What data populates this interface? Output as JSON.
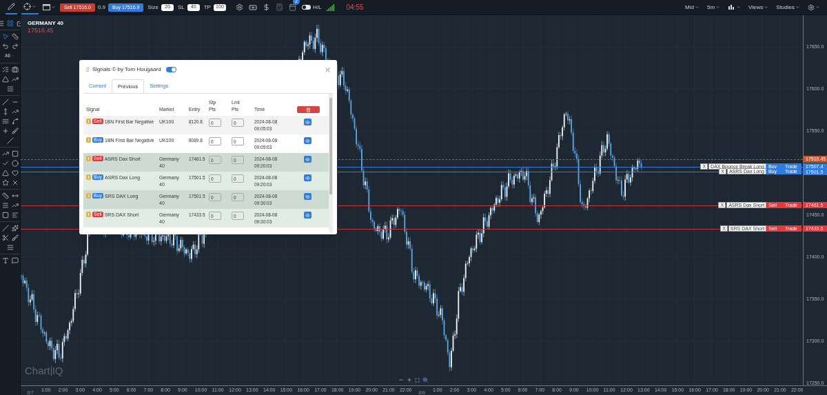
{
  "toolbar": {
    "tools": [
      {
        "kind": "pencil",
        "selected": true
      },
      {
        "kind": "crosshair",
        "selected": true
      }
    ],
    "sell_button": "Sell 17516.0",
    "spread": "0.9",
    "buy_button": "Buy 17516.9",
    "fields": [
      {
        "label": "Size",
        "value": "20"
      },
      {
        "label": "SL",
        "value": "40"
      },
      {
        "label": "TP",
        "value": "100"
      }
    ],
    "calendar_badge": "2",
    "hl_toggle": {
      "label": "H/L",
      "on": false
    },
    "clock": "04:55",
    "menus": [
      {
        "kind": "text",
        "label": "Mid"
      },
      {
        "kind": "text",
        "label": "5m"
      },
      {
        "kind": "chart-type"
      },
      {
        "kind": "text",
        "label": "Views"
      },
      {
        "kind": "text",
        "label": "Studies"
      },
      {
        "kind": "settings"
      }
    ]
  },
  "sidebar": {
    "filter": "All"
  },
  "chart": {
    "symbol": "GERMANY 40",
    "price": "17516.45",
    "logo": {
      "main": "Chart",
      "suffix": "IQ"
    },
    "y_axis": [
      "17650.0",
      "17600.0",
      "17550.0",
      "17450.0",
      "17400.0",
      "17350.0",
      "17300.0",
      "17250.0"
    ],
    "x_axis": [
      {
        "date": "8/7",
        "hours": [
          "1:00",
          "2:00",
          "3:00",
          "4:00",
          "5:00",
          "6:00",
          "7:00",
          "8:00",
          "9:00",
          "10:00",
          "11:00",
          "12:00",
          "13:00",
          "14:00",
          "15:00",
          "16:00",
          "17:00",
          "18:00",
          "19:00",
          "20:00",
          "21:00",
          "22:00"
        ]
      },
      {
        "date": "8/8",
        "hours": [
          "1:00",
          "2:00",
          "3:00",
          "4:00",
          "5:00",
          "6:00",
          "7:00",
          "8:00",
          "9:00",
          "10:00",
          "11:00",
          "12:00",
          "13:00",
          "14:00",
          "15:00",
          "16:00",
          "17:00",
          "18:00",
          "19:00",
          "20:00",
          "21:00",
          "22:00"
        ]
      }
    ],
    "current_price": "17516.45",
    "orders": [
      {
        "close": "X",
        "name": "DAX Bounce Break Long",
        "kind": "buy",
        "side": "Buy",
        "action": "Trade",
        "price": "17507.4"
      },
      {
        "close": "X",
        "name": "ASRS Dax Long",
        "kind": "buy",
        "side": "Buy",
        "action": "Trade",
        "price": "17501.5"
      },
      {
        "close": "X",
        "name": "ASRS Dax Short",
        "kind": "sell",
        "side": "Sell",
        "action": "Trade",
        "price": "17461.5"
      },
      {
        "close": "X",
        "name": "SRS DAX Short",
        "kind": "sell",
        "side": "Sell",
        "action": "Trade",
        "price": "17433.5"
      }
    ]
  },
  "signals_dialog": {
    "title": "Signals © by Tom Hougaard",
    "on": true,
    "tabs": [
      {
        "label": "Current",
        "selected": false
      },
      {
        "label": "Previous",
        "selected": true
      },
      {
        "label": "Settings",
        "selected": false
      }
    ],
    "columns": [
      "Signal",
      "Market",
      "Entry",
      "Stp Pts",
      "Lmt Pts",
      "Time"
    ],
    "rows": [
      {
        "kind": "sell",
        "side": "Sell",
        "signal": "1BN First Bar Negative",
        "market": "UK100",
        "entry": "8120.8",
        "stop": "0",
        "limit": "0",
        "time": "2024-08-08 09:05:03",
        "highlighted": false
      },
      {
        "kind": "buy",
        "side": "Buy",
        "signal": "1BN First Bar Negative",
        "market": "UK100",
        "entry": "8089.8",
        "stop": "0",
        "limit": "0",
        "time": "2024-08-08 09:05:03",
        "highlighted": false
      },
      {
        "kind": "sell",
        "side": "Sell",
        "signal": "ASRS Dax Short",
        "market": "Germany 40",
        "entry": "17461.5",
        "stop": "0",
        "limit": "0",
        "time": "2024-08-08 09:20:03",
        "highlighted": true
      },
      {
        "kind": "buy",
        "side": "Buy",
        "signal": "ASRS Dax Long",
        "market": "Germany 40",
        "entry": "17501.5",
        "stop": "0",
        "limit": "0",
        "time": "2024-08-08 09:20:03",
        "highlighted": true
      },
      {
        "kind": "buy",
        "side": "Buy",
        "signal": "SRS DAX Long",
        "market": "Germany 40",
        "entry": "17501.5",
        "stop": "0",
        "limit": "0",
        "time": "2024-08-08 09:30:03",
        "highlighted": true
      },
      {
        "kind": "sell",
        "side": "Sell",
        "signal": "SRS DAX Short",
        "market": "Germany 40",
        "entry": "17433.5",
        "stop": "0",
        "limit": "0",
        "time": "2024-08-08 09:30:03",
        "highlighted": true
      }
    ]
  }
}
